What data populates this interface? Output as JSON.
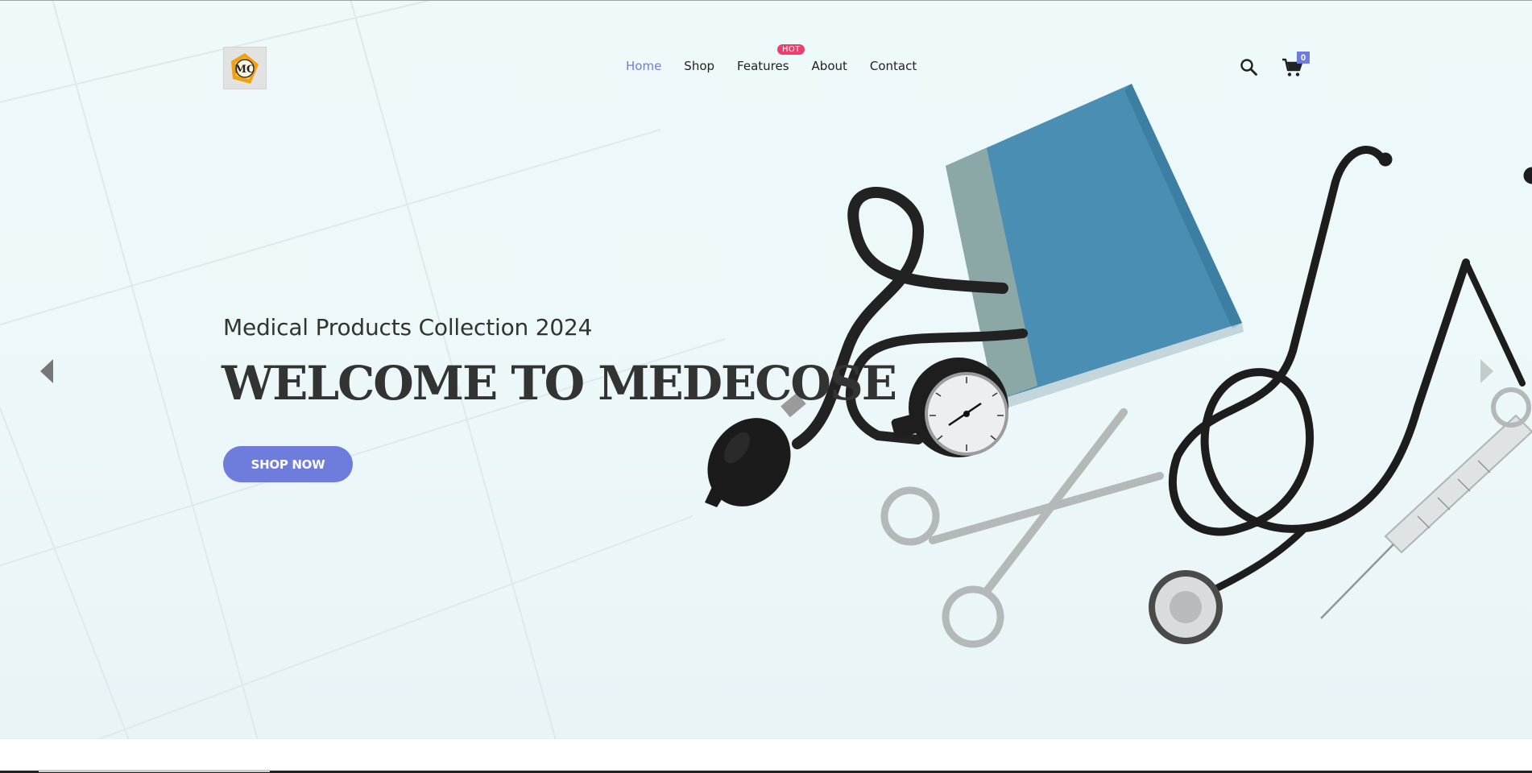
{
  "header": {
    "logo_text": "MC",
    "nav": [
      {
        "label": "Home",
        "active": true
      },
      {
        "label": "Shop",
        "active": false
      },
      {
        "label": "Features",
        "active": false,
        "badge": "HOT"
      },
      {
        "label": "About",
        "active": false
      },
      {
        "label": "Contact",
        "active": false
      }
    ],
    "cart_count": "0",
    "icons": {
      "search": "search-icon",
      "cart": "cart-icon"
    }
  },
  "hero": {
    "subtitle": "Medical Products Collection 2024",
    "title": "WELCOME TO MEDECOSE",
    "cta_label": "SHOP NOW"
  },
  "colors": {
    "accent": "#6e7ddc",
    "badge": "#ee3f6c",
    "text": "#333333",
    "background": "#eef9fa"
  }
}
